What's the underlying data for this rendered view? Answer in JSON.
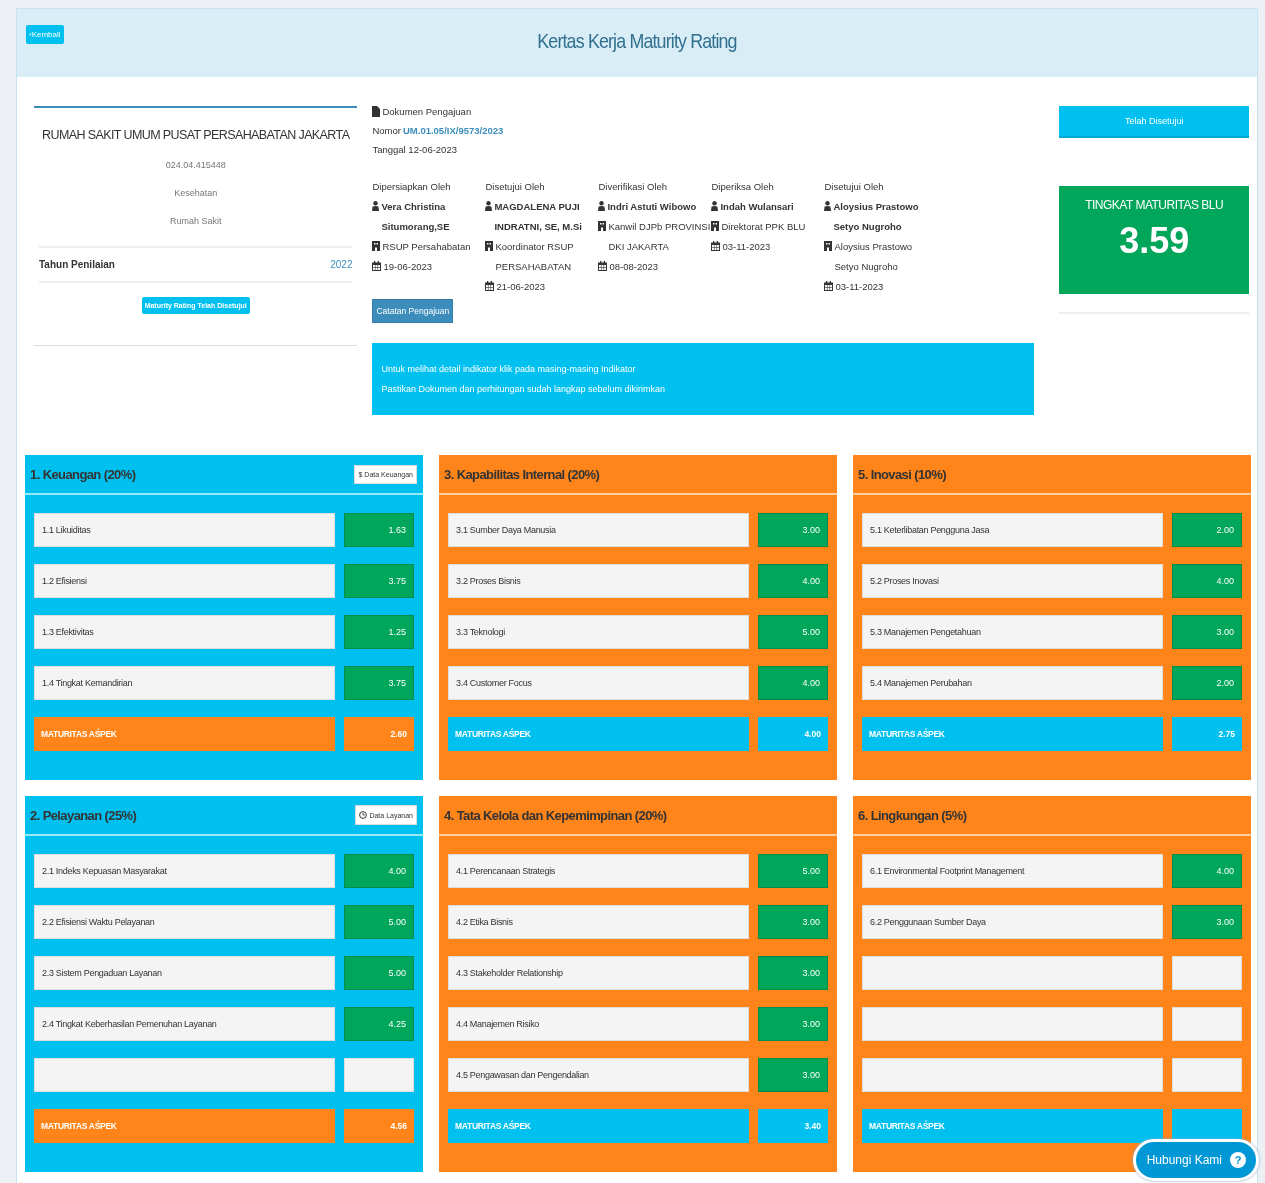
{
  "header": {
    "back_button": "‹Kembali",
    "title": "Kertas Kerja Maturity Rating"
  },
  "entity": {
    "name": "RUMAH SAKIT UMUM PUSAT PERSAHABATAN JAKARTA",
    "code": "024.04.415448",
    "sector": "Kesehatan",
    "type": "Rumah Sakit",
    "year_label": "Tahun Penilaian",
    "year": "2022",
    "status_button": "Maturity Rating Telah Disetujui"
  },
  "document": {
    "title": "Dokumen Pengajuan",
    "number_label": "Nomor",
    "number": "UM.01.05/IX/9573/2023",
    "date": "Tanggal 12-06-2023"
  },
  "signers": [
    {
      "role": "Dipersiapkan Oleh",
      "name": "Vera Christina Situmorang,SE",
      "org": "RSUP Persahabatan",
      "date": "19-06-2023"
    },
    {
      "role": "Disetujui Oleh",
      "name": "MAGDALENA PUJI INDRATNI, SE, M.Si",
      "org": "Koordinator RSUP PERSAHABATAN",
      "date": "21-06-2023"
    },
    {
      "role": "Diverifikasi Oleh",
      "name": "Indri Astuti Wibowo",
      "org": "Kanwil DJPb PROVINSI DKI JAKARTA",
      "date": "08-08-2023"
    },
    {
      "role": "Diperiksa Oleh",
      "name": "Indah Wulansari",
      "org": "Direktorat PPK BLU",
      "date": "03-11-2023"
    },
    {
      "role": "Disetujui Oleh",
      "name": "Aloysius Prastowo Setyo Nugroho",
      "org": "Aloysius Prastowo Setyo Nugroho",
      "date": "03-11-2023"
    }
  ],
  "notes_button": "Catatan Pengajuan",
  "info": [
    "Untuk melihat detail indikator klik pada masing-masing Indikator",
    "Pastikan Dokumen dan perhitungan sudah langkap sebelum dikirimkan"
  ],
  "approval_button": "Telah Disetujui",
  "score": {
    "label": "TINGKAT MATURITAS BLU",
    "value": "3.59"
  },
  "panels": [
    {
      "title": "1. Keuangan (20%)",
      "color": "#00c0ef",
      "action": {
        "kind": "dollar",
        "icon": "$",
        "label": "Data Keuangan"
      },
      "rows": [
        {
          "kind": "item",
          "label": "1.1 Likuiditas",
          "value": "1.63"
        },
        {
          "kind": "item",
          "label": "1.2 Efisiensi",
          "value": "3.75"
        },
        {
          "kind": "item",
          "label": "1.3 Efektivitas",
          "value": "1.25"
        },
        {
          "kind": "item",
          "label": "1.4 Tingkat Kemandirian",
          "value": "3.75"
        }
      ],
      "summary": {
        "label": "MATURITAS AŚPEK",
        "value": "2.60"
      }
    },
    {
      "title": "3. Kapabilitas Internal (20%)",
      "color": "#ff851b",
      "rows": [
        {
          "kind": "item",
          "label": "3.1 Sumber Daya Manusia",
          "value": "3.00"
        },
        {
          "kind": "item",
          "label": "3.2 Proses Bisnis",
          "value": "4.00"
        },
        {
          "kind": "item",
          "label": "3.3 Teknologi",
          "value": "5.00"
        },
        {
          "kind": "item",
          "label": "3.4 Customer Focus",
          "value": "4.00"
        }
      ],
      "summary": {
        "label": "MATURITAS AŚPEK",
        "value": "4.00"
      }
    },
    {
      "title": "5. Inovasi (10%)",
      "color": "#ff851b",
      "rows": [
        {
          "kind": "item",
          "label": "5.1 Keterlibatan Pengguna Jasa",
          "value": "2.00"
        },
        {
          "kind": "item",
          "label": "5.2 Proses Inovasi",
          "value": "4.00"
        },
        {
          "kind": "item",
          "label": "5.3 Manajemen Pengetahuan",
          "value": "3.00"
        },
        {
          "kind": "item",
          "label": "5.4 Manajemen Perubahan",
          "value": "2.00"
        }
      ],
      "summary": {
        "label": "MATURITAS AŚPEK",
        "value": "2.75"
      }
    },
    {
      "title": "2. Pelayanan (25%)",
      "color": "#00c0ef",
      "action": {
        "kind": "clock",
        "label": "Data Layanan"
      },
      "rows": [
        {
          "kind": "item",
          "label": "2.1 Indeks Kepuasan Masyarakat",
          "value": "4.00"
        },
        {
          "kind": "item",
          "label": "2.2 Efisiensi Waktu Pelayanan",
          "value": "5.00"
        },
        {
          "kind": "item",
          "label": "2.3 Sistem Pengaduan Layanan",
          "value": "5.00"
        },
        {
          "kind": "item",
          "label": "2.4 Tingkat Keberhasilan Pemenuhan Layanan",
          "value": "4.25"
        },
        {
          "kind": "empty"
        }
      ],
      "summary": {
        "label": "MATURITAS AŚPEK",
        "value": "4.56"
      }
    },
    {
      "title": "4. Tata Kelola dan Kepemimpinan (20%)",
      "color": "#ff851b",
      "rows": [
        {
          "kind": "item",
          "label": "4.1 Perencanaan Strategis",
          "value": "5.00"
        },
        {
          "kind": "item",
          "label": "4.2 Etika Bisnis",
          "value": "3.00"
        },
        {
          "kind": "item",
          "label": "4.3 Stakeholder Relationship",
          "value": "3.00"
        },
        {
          "kind": "item",
          "label": "4.4 Manajemen Risiko",
          "value": "3.00"
        },
        {
          "kind": "item",
          "label": "4.5 Pengawasan dan Pengendalian",
          "value": "3.00"
        }
      ],
      "summary": {
        "label": "MATURITAS AŚPEK",
        "value": "3.40"
      }
    },
    {
      "title": "6. Lingkungan (5%)",
      "color": "#ff851b",
      "rows": [
        {
          "kind": "item",
          "label": "6.1 Environmental Footprint Management",
          "value": "4.00"
        },
        {
          "kind": "item",
          "label": "6.2 Penggunaan Sumber Daya",
          "value": "3.00"
        },
        {
          "kind": "empty"
        },
        {
          "kind": "empty"
        },
        {
          "kind": "empty"
        }
      ],
      "summary": {
        "label": "MATURITAS AŚPEK"
      }
    }
  ],
  "help_button": {
    "label": "Hubungi Kami",
    "icon": "?"
  }
}
